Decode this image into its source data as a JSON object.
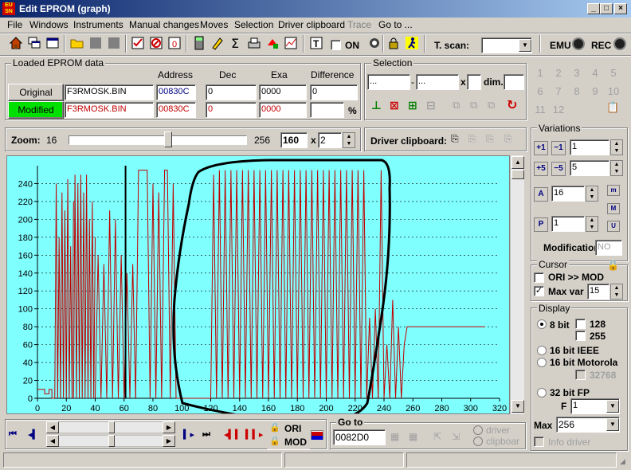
{
  "window": {
    "title": "Edit EPROM (graph)",
    "icon_text": "EU SN",
    "buttons": [
      "_",
      "□",
      "×"
    ]
  },
  "menu": [
    "File",
    "Windows",
    "Instruments",
    "Manual changes",
    "Moves",
    "Selection",
    "Driver clipboard",
    "Trace",
    "Go to ..."
  ],
  "toolbar": {
    "on_label": "ON",
    "tscan_label": "T. scan:",
    "emu_label": "EMU",
    "rec_label": "REC"
  },
  "loaded": {
    "title": "Loaded EPROM data",
    "col_address": "Address",
    "col_dec": "Dec",
    "col_exa": "Exa",
    "col_diff": "Difference",
    "original": {
      "label": "Original",
      "file": "F3RMOSK.BIN",
      "address": "00830C",
      "dec": "0",
      "exa": "0000",
      "diff": "0"
    },
    "modified": {
      "label": "Modified",
      "file": "F3RMOSK.BIN",
      "address": "00830C",
      "dec": "0",
      "exa": "0000",
      "diff": "",
      "pct": "%"
    }
  },
  "selection": {
    "title": "Selection",
    "from": "...",
    "to": "...",
    "x_label": "x",
    "dim_label": "dim."
  },
  "numpad": [
    "1",
    "2",
    "3",
    "4",
    "5",
    "6",
    "7",
    "8",
    "9",
    "10",
    "11",
    "12"
  ],
  "zoom": {
    "label": "Zoom:",
    "min": "16",
    "max": "256",
    "value": "160",
    "x_label": "x",
    "mult": "2",
    "slider_pct": 56
  },
  "driver_clipboard": {
    "label": "Driver clipboard:"
  },
  "variations": {
    "title": "Variations",
    "v1": "1",
    "v2": "5",
    "v3": "16",
    "v4": "1",
    "modification_label": "Modification",
    "modification_value": "NO"
  },
  "cursor": {
    "title": "Cursor",
    "ori_mod": "ORI >> MOD",
    "max_var_label": "Max var",
    "max_var_value": "15"
  },
  "display": {
    "title": "Display",
    "opt_8bit": "8 bit",
    "opt_128": "128",
    "opt_255": "255",
    "opt_16ieee": "16 bit IEEE",
    "opt_16moto": "16 bit Motorola",
    "opt_32768": "32768",
    "opt_32fp": "32 bit FP",
    "f_label": "F",
    "f_value": "1",
    "max_label": "Max",
    "max_value": "256",
    "info_driver": "Info driver"
  },
  "bottom": {
    "ori_label": "ORI",
    "mod_label": "MOD",
    "goto_title": "Go to",
    "goto_value": "0082D0",
    "driver_label": "driver",
    "clipboard_label": "clipboar"
  },
  "chart_data": {
    "type": "line",
    "xlim": [
      0,
      320
    ],
    "ylim": [
      0,
      260
    ],
    "x_ticks": [
      0,
      20,
      40,
      60,
      80,
      100,
      120,
      140,
      160,
      180,
      200,
      220,
      240,
      260,
      280,
      300,
      320
    ],
    "y_ticks": [
      0,
      20,
      40,
      60,
      80,
      100,
      120,
      140,
      160,
      180,
      200,
      220,
      240
    ],
    "grid": true,
    "series_color": "#c00000",
    "cursor_x": 61,
    "segments": [
      {
        "x": [
          0,
          5,
          5,
          8,
          8,
          10,
          10,
          12
        ],
        "y": [
          10,
          10,
          5,
          5,
          10,
          10,
          0,
          0
        ]
      },
      {
        "x": [
          12,
          13,
          14,
          15,
          16,
          17,
          18,
          19,
          20,
          21,
          22,
          23,
          24,
          25
        ],
        "y": [
          0,
          240,
          0,
          180,
          0,
          230,
          0,
          210,
          0,
          245,
          0,
          170,
          0,
          220
        ]
      },
      {
        "x": [
          25,
          26,
          27,
          28,
          29,
          30,
          31,
          32,
          33,
          34,
          35,
          36,
          37,
          38,
          39,
          40
        ],
        "y": [
          0,
          250,
          0,
          240,
          0,
          250,
          0,
          230,
          0,
          250,
          0,
          200,
          0,
          220,
          0,
          180
        ]
      },
      {
        "x": [
          40,
          42,
          44,
          46,
          48,
          50,
          52,
          54,
          56,
          58,
          60,
          62,
          64,
          66,
          68
        ],
        "y": [
          0,
          160,
          0,
          150,
          0,
          210,
          0,
          200,
          0,
          160,
          0,
          140,
          0,
          150,
          0
        ]
      },
      {
        "x": [
          68,
          70,
          70,
          76,
          76,
          78,
          80,
          82,
          84,
          86,
          88,
          88,
          90,
          92,
          94,
          96,
          98
        ],
        "y": [
          0,
          255,
          255,
          255,
          255,
          0,
          240,
          0,
          230,
          0,
          250,
          255,
          255,
          0,
          240,
          0,
          0
        ]
      },
      {
        "x": [
          98,
          100,
          102,
          104,
          106,
          108,
          110,
          112,
          114,
          116,
          118,
          120
        ],
        "y": [
          0,
          0,
          0,
          0,
          0,
          0,
          0,
          0,
          0,
          0,
          0,
          0
        ]
      },
      {
        "x": [
          120,
          122,
          124,
          126,
          128,
          130,
          132,
          134,
          136,
          138,
          140,
          142,
          144,
          146,
          148,
          150,
          152,
          154,
          156,
          158,
          160
        ],
        "y": [
          0,
          250,
          0,
          255,
          0,
          255,
          0,
          255,
          0,
          255,
          0,
          255,
          0,
          255,
          0,
          255,
          0,
          255,
          0,
          255,
          0
        ]
      },
      {
        "x": [
          160,
          162,
          164,
          166,
          168,
          170,
          172,
          174,
          176,
          178,
          180,
          182,
          184,
          186,
          188,
          190,
          192,
          194,
          196,
          198,
          200
        ],
        "y": [
          0,
          255,
          0,
          255,
          0,
          255,
          0,
          255,
          0,
          255,
          0,
          255,
          0,
          255,
          0,
          255,
          0,
          255,
          0,
          255,
          0
        ]
      },
      {
        "x": [
          200,
          202,
          204,
          206,
          208,
          210,
          212,
          214,
          216,
          218,
          220,
          222,
          224,
          226,
          228,
          230,
          232,
          234,
          236
        ],
        "y": [
          0,
          255,
          0,
          255,
          0,
          255,
          0,
          255,
          0,
          255,
          0,
          255,
          0,
          255,
          0,
          90,
          0,
          100,
          0
        ]
      },
      {
        "x": [
          236,
          238,
          240,
          242,
          244,
          246,
          248,
          250,
          252,
          254,
          256,
          260,
          280,
          300,
          310
        ],
        "y": [
          0,
          255,
          0,
          60,
          0,
          110,
          0,
          80,
          0,
          60,
          80,
          80,
          80,
          80,
          80
        ]
      }
    ]
  }
}
